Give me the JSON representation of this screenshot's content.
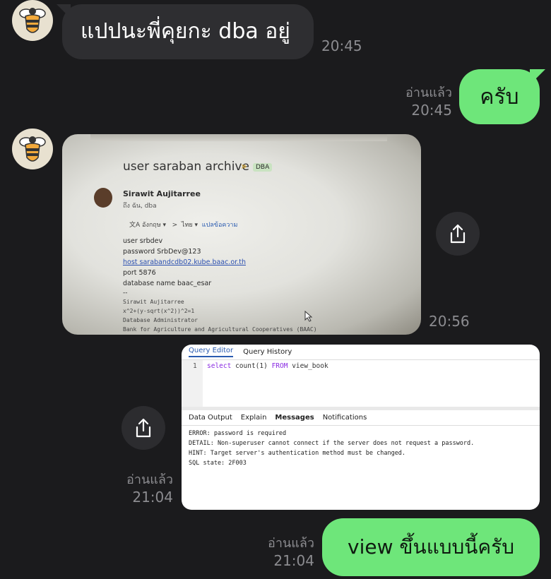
{
  "messages": {
    "m1": {
      "text": "แปปนะพี่คุยกะ dba อยู่",
      "time": "20:45"
    },
    "m2": {
      "text": "ครับ",
      "read": "อ่านแล้ว",
      "time": "20:45"
    },
    "m3": {
      "time": "20:56",
      "photo": {
        "heading": "user saraban archive",
        "tag": "DBA",
        "sender": "Sirawit Aujitarree",
        "to": "ถึง ฉัน, dba",
        "translate_from": "อังกฤษ",
        "translate_to": "ไทย",
        "translate_link": "แปลข้อความ",
        "lines": [
          "user srbdev",
          "password SrbDev@123",
          "host sarabandcdb02.kube.baac.or.th",
          "port 5876",
          "database name baac_esar"
        ],
        "signature": [
          "Sirawit Aujitarree",
          "x^2+(y-sqrt(x^2))^2=1",
          "Database Administrator",
          "Bank for Agriculture and Agricultural Cooperatives (BAAC)"
        ]
      }
    },
    "m4": {
      "read": "อ่านแล้ว",
      "time": "21:04",
      "screenshot": {
        "tabs": [
          "Query Editor",
          "Query History"
        ],
        "query_line_no": "1",
        "query_parts": [
          "select",
          "count(1)",
          "FROM",
          "view_book"
        ],
        "result_tabs": [
          "Data Output",
          "Explain",
          "Messages",
          "Notifications"
        ],
        "output": [
          "ERROR:  password is required",
          "DETAIL:  Non-superuser cannot connect if the server does not request a password.",
          "HINT:  Target server's authentication method must be changed.",
          "SQL state: 2F003"
        ]
      }
    },
    "m5": {
      "text": "view ขึ้นแบบนี้ครับ",
      "read": "อ่านแล้ว",
      "time": "21:04"
    }
  },
  "icons": {
    "avatar": "bee-icon",
    "share": "share-icon"
  },
  "colors": {
    "background": "#1b1b1d",
    "incoming_bubble": "#2e2e31",
    "outgoing_bubble": "#6ee67a",
    "meta_text": "#8c8c90"
  }
}
